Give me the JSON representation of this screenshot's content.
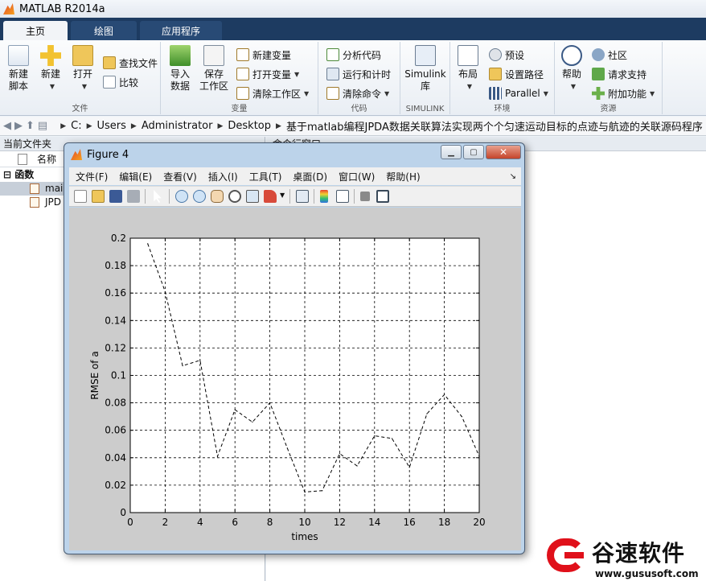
{
  "window": {
    "title": "MATLAB R2014a"
  },
  "tabs": [
    {
      "label": "主页",
      "active": true
    },
    {
      "label": "绘图",
      "active": false
    },
    {
      "label": "应用程序",
      "active": false
    }
  ],
  "ribbon": {
    "file": {
      "group_label": "文件",
      "new_script": "新建\n脚本",
      "new": "新建",
      "open": "打开",
      "find_files": "查找文件",
      "compare": "比较"
    },
    "variable": {
      "group_label": "变量",
      "import_data": "导入\n数据",
      "save_workspace": "保存\n工作区",
      "new_variable": "新建变量",
      "open_variable": "打开变量",
      "clear_workspace": "清除工作区"
    },
    "code": {
      "group_label": "代码",
      "analyze_code": "分析代码",
      "run_and_time": "运行和计时",
      "clear_commands": "清除命令"
    },
    "simulink": {
      "group_label": "SIMULINK",
      "simulink_library": "Simulink\n库"
    },
    "environment": {
      "group_label": "环境",
      "layout": "布局",
      "preferences": "预设",
      "set_path": "设置路径",
      "parallel": "Parallel"
    },
    "resources": {
      "group_label": "资源",
      "help": "帮助",
      "community": "社区",
      "request_support": "请求支持",
      "add_ons": "附加功能"
    }
  },
  "address": {
    "crumbs": [
      "C:",
      "Users",
      "Administrator",
      "Desktop",
      "基于matlab编程JPDA数据关联算法实现两个个匀速运动目标的点迹与航迹的关联源码程序"
    ]
  },
  "current_folder": {
    "title": "当前文件夹",
    "column_name": "名称",
    "group": "函数",
    "files": [
      "mai",
      "JPD"
    ]
  },
  "command_window": {
    "title": "命令行窗口"
  },
  "figure": {
    "title": "Figure 4",
    "menu": [
      "文件(F)",
      "编辑(E)",
      "查看(V)",
      "插入(I)",
      "工具(T)",
      "桌面(D)",
      "窗口(W)",
      "帮助(H)"
    ],
    "toolbar_icons": [
      "new-figure-icon",
      "open-file-icon",
      "save-icon",
      "print-icon",
      "select-arrow-icon",
      "zoom-in-icon",
      "zoom-out-icon",
      "pan-hand-icon",
      "rotate-icon",
      "data-cursor-icon",
      "brush-icon",
      "link-plot-icon",
      "colorbar-icon",
      "legend-icon",
      "hide-plot-tools-icon",
      "show-plot-tools-icon"
    ]
  },
  "chart_data": {
    "type": "line",
    "title": "",
    "xlabel": "times",
    "ylabel": "RMSE of a",
    "xlim": [
      0,
      20
    ],
    "ylim": [
      0,
      0.2
    ],
    "xticks": [
      0,
      2,
      4,
      6,
      8,
      10,
      12,
      14,
      16,
      18,
      20
    ],
    "yticks": [
      0,
      0.02,
      0.04,
      0.06,
      0.08,
      0.1,
      0.12,
      0.14,
      0.16,
      0.18,
      0.2
    ],
    "ytick_labels": [
      "0",
      "0.02",
      "0.04",
      "0.06",
      "0.08",
      "0.1",
      "0.12",
      "0.14",
      "0.16",
      "0.18",
      "0.2"
    ],
    "grid": true,
    "line_style": "dashed",
    "line_color": "#000000",
    "series": [
      {
        "x": [
          1,
          2,
          3,
          4,
          5,
          6,
          7,
          8,
          9,
          10,
          11,
          12,
          13,
          14,
          15,
          16,
          17,
          18,
          19,
          20
        ],
        "values": [
          0.196,
          0.161,
          0.107,
          0.111,
          0.041,
          0.075,
          0.066,
          0.08,
          0.047,
          0.015,
          0.016,
          0.043,
          0.034,
          0.056,
          0.054,
          0.033,
          0.072,
          0.086,
          0.07,
          0.041
        ]
      }
    ]
  },
  "watermark": {
    "name": "谷速软件",
    "url": "www.gususoft.com"
  }
}
